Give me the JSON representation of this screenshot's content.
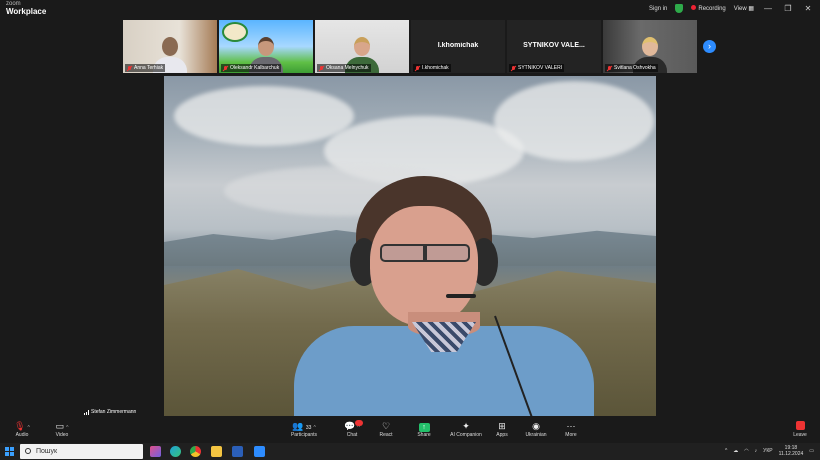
{
  "app": {
    "brand_top": "zoom",
    "brand_main": "Workplace"
  },
  "titlebar": {
    "signin": "Sign in",
    "recording": "Recording",
    "view": "View"
  },
  "gallery": {
    "tiles": [
      {
        "name": "Anna Terhiak",
        "has_video": true
      },
      {
        "name": "Oleksandr Kalbarchuk",
        "has_video": true
      },
      {
        "name": "Oksana Melnychuk",
        "has_video": true
      },
      {
        "name": "I.khomichak",
        "big_label": "I.khomichak",
        "has_video": false
      },
      {
        "name": "SYTNIKOV VALERI",
        "big_label": "SYTNIKOV VALE...",
        "has_video": false
      },
      {
        "name": "Svitlana Oshvokha",
        "has_video": true
      }
    ]
  },
  "main_video": {
    "speaker_name": "Stefan Zimmermann"
  },
  "toolbar": {
    "audio": "Audio",
    "video": "Video",
    "participants": "Participants",
    "participants_count": "33",
    "chat": "Chat",
    "react": "React",
    "share": "Share",
    "ai_companion": "AI Companion",
    "apps": "Apps",
    "language": "Ukrainian",
    "more": "More",
    "leave": "Leave"
  },
  "taskbar": {
    "search_placeholder": "Пошук",
    "lang": "УКР",
    "time": "19:18",
    "date": "11.12.2024"
  },
  "colors": {
    "accent": "#2d8cff",
    "share": "#23c06a",
    "danger": "#e23333"
  }
}
